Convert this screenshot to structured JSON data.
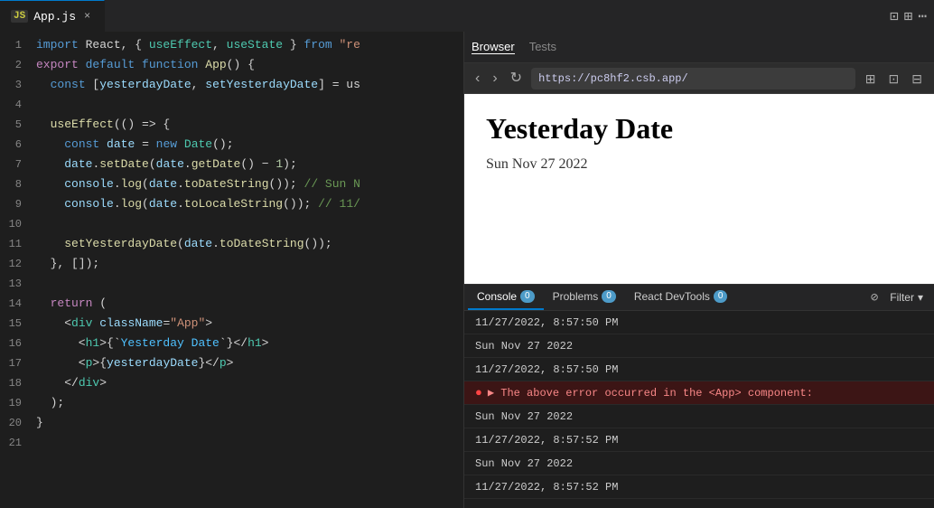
{
  "tabs": [
    {
      "id": "app-js",
      "label": "App.js",
      "icon": "JS",
      "active": true,
      "close": "×"
    }
  ],
  "tab_actions": [
    "⊡",
    "⊞",
    "⋯"
  ],
  "browser": {
    "tabs": [
      {
        "label": "Browser",
        "active": true
      },
      {
        "label": "Tests",
        "active": false
      }
    ],
    "nav": {
      "back": "‹",
      "forward": "›",
      "refresh": "↻",
      "url": "https://pc8hf2.csb.app/"
    },
    "toolbar_icons": [
      "⊞",
      "⊡",
      "⊟"
    ],
    "page": {
      "title": "Yesterday Date",
      "date": "Sun Nov 27 2022"
    }
  },
  "console": {
    "tabs": [
      {
        "label": "Console",
        "badge": "0",
        "active": true
      },
      {
        "label": "Problems",
        "badge": "0",
        "active": false
      },
      {
        "label": "React DevTools",
        "badge": "0",
        "active": false
      }
    ],
    "filter_label": "Filter",
    "messages": [
      {
        "type": "log",
        "text": "11/27/2022, 8:57:50 PM"
      },
      {
        "type": "log",
        "text": "Sun Nov 27 2022"
      },
      {
        "type": "log",
        "text": "11/27/2022, 8:57:50 PM"
      },
      {
        "type": "error",
        "text": "▶ The above error occurred in the <App> component:"
      },
      {
        "type": "log",
        "text": "Sun Nov 27 2022"
      },
      {
        "type": "log",
        "text": "11/27/2022, 8:57:52 PM"
      },
      {
        "type": "log",
        "text": "Sun Nov 27 2022"
      },
      {
        "type": "log",
        "text": "11/27/2022, 8:57:52 PM"
      }
    ]
  },
  "code": {
    "lines": [
      {
        "num": 1,
        "tokens": [
          {
            "t": "kw",
            "v": "import"
          },
          {
            "t": "punct",
            "v": " React, { "
          },
          {
            "t": "cls",
            "v": "useEffect"
          },
          {
            "t": "punct",
            "v": ", "
          },
          {
            "t": "cls",
            "v": "useState"
          },
          {
            "t": "punct",
            "v": " } "
          },
          {
            "t": "kw",
            "v": "from"
          },
          {
            "t": "str",
            "v": " \"re"
          }
        ]
      },
      {
        "num": 2,
        "tokens": [
          {
            "t": "kw2",
            "v": "export"
          },
          {
            "t": "kw",
            "v": " default"
          },
          {
            "t": "kw",
            "v": " function"
          },
          {
            "t": "punct",
            "v": " "
          },
          {
            "t": "fn",
            "v": "App"
          },
          {
            "t": "punct",
            "v": "() {"
          }
        ]
      },
      {
        "num": 3,
        "tokens": [
          {
            "t": "punct",
            "v": "  "
          },
          {
            "t": "kw",
            "v": "const"
          },
          {
            "t": "punct",
            "v": " ["
          },
          {
            "t": "var",
            "v": "yesterdayDate"
          },
          {
            "t": "punct",
            "v": ", "
          },
          {
            "t": "var",
            "v": "setYesterdayDate"
          },
          {
            "t": "punct",
            "v": "] = us"
          }
        ]
      },
      {
        "num": 4,
        "tokens": []
      },
      {
        "num": 5,
        "tokens": [
          {
            "t": "punct",
            "v": "  "
          },
          {
            "t": "fn",
            "v": "useEffect"
          },
          {
            "t": "punct",
            "v": "(() => {"
          }
        ]
      },
      {
        "num": 6,
        "tokens": [
          {
            "t": "punct",
            "v": "    "
          },
          {
            "t": "kw",
            "v": "const"
          },
          {
            "t": "punct",
            "v": " "
          },
          {
            "t": "var",
            "v": "date"
          },
          {
            "t": "punct",
            "v": " = "
          },
          {
            "t": "kw",
            "v": "new"
          },
          {
            "t": "punct",
            "v": " "
          },
          {
            "t": "cls",
            "v": "Date"
          },
          {
            "t": "punct",
            "v": "();"
          }
        ]
      },
      {
        "num": 7,
        "tokens": [
          {
            "t": "punct",
            "v": "    "
          },
          {
            "t": "var",
            "v": "date"
          },
          {
            "t": "punct",
            "v": "."
          },
          {
            "t": "fn",
            "v": "setDate"
          },
          {
            "t": "punct",
            "v": "("
          },
          {
            "t": "var",
            "v": "date"
          },
          {
            "t": "punct",
            "v": "."
          },
          {
            "t": "fn",
            "v": "getDate"
          },
          {
            "t": "punct",
            "v": "() − "
          },
          {
            "t": "num",
            "v": "1"
          },
          {
            "t": "punct",
            "v": ");"
          }
        ]
      },
      {
        "num": 8,
        "tokens": [
          {
            "t": "punct",
            "v": "    "
          },
          {
            "t": "var",
            "v": "console"
          },
          {
            "t": "punct",
            "v": "."
          },
          {
            "t": "fn",
            "v": "log"
          },
          {
            "t": "punct",
            "v": "("
          },
          {
            "t": "var",
            "v": "date"
          },
          {
            "t": "punct",
            "v": "."
          },
          {
            "t": "fn",
            "v": "toDateString"
          },
          {
            "t": "punct",
            "v": "()); "
          },
          {
            "t": "cmt",
            "v": "// Sun N"
          }
        ]
      },
      {
        "num": 9,
        "tokens": [
          {
            "t": "punct",
            "v": "    "
          },
          {
            "t": "var",
            "v": "console"
          },
          {
            "t": "punct",
            "v": "."
          },
          {
            "t": "fn",
            "v": "log"
          },
          {
            "t": "punct",
            "v": "("
          },
          {
            "t": "var",
            "v": "date"
          },
          {
            "t": "punct",
            "v": "."
          },
          {
            "t": "fn",
            "v": "toLocaleString"
          },
          {
            "t": "punct",
            "v": "()); "
          },
          {
            "t": "cmt",
            "v": "// 11/"
          }
        ]
      },
      {
        "num": 10,
        "tokens": []
      },
      {
        "num": 11,
        "tokens": [
          {
            "t": "punct",
            "v": "    "
          },
          {
            "t": "fn",
            "v": "setYesterdayDate"
          },
          {
            "t": "punct",
            "v": "("
          },
          {
            "t": "var",
            "v": "date"
          },
          {
            "t": "punct",
            "v": "."
          },
          {
            "t": "fn",
            "v": "toDateString"
          },
          {
            "t": "punct",
            "v": "());"
          }
        ]
      },
      {
        "num": 12,
        "tokens": [
          {
            "t": "punct",
            "v": "  }, []);"
          }
        ]
      },
      {
        "num": 13,
        "tokens": []
      },
      {
        "num": 14,
        "tokens": [
          {
            "t": "punct",
            "v": "  "
          },
          {
            "t": "kw2",
            "v": "return"
          },
          {
            "t": "punct",
            "v": " ("
          }
        ]
      },
      {
        "num": 15,
        "tokens": [
          {
            "t": "punct",
            "v": "    <"
          },
          {
            "t": "jsx-tag",
            "v": "div"
          },
          {
            "t": "punct",
            "v": " "
          },
          {
            "t": "jsx-attr",
            "v": "className"
          },
          {
            "t": "punct",
            "v": "="
          },
          {
            "t": "jsx-str",
            "v": "\"App\""
          },
          {
            "t": "punct",
            "v": ">"
          }
        ]
      },
      {
        "num": 16,
        "tokens": [
          {
            "t": "punct",
            "v": "      <"
          },
          {
            "t": "jsx-tag",
            "v": "h1"
          },
          {
            "t": "punct",
            "v": ">{`"
          },
          {
            "t": "tpl",
            "v": "Yesterday Date"
          },
          {
            "t": "punct",
            "v": "`}</"
          },
          {
            "t": "jsx-tag",
            "v": "h1"
          },
          {
            "t": "punct",
            "v": ">"
          }
        ]
      },
      {
        "num": 17,
        "tokens": [
          {
            "t": "punct",
            "v": "      <"
          },
          {
            "t": "jsx-tag",
            "v": "p"
          },
          {
            "t": "punct",
            "v": ">{"
          },
          {
            "t": "var",
            "v": "yesterdayDate"
          },
          {
            "t": "punct",
            "v": "}</"
          },
          {
            "t": "jsx-tag",
            "v": "p"
          },
          {
            "t": "punct",
            "v": ">"
          }
        ]
      },
      {
        "num": 18,
        "tokens": [
          {
            "t": "punct",
            "v": "    </"
          },
          {
            "t": "jsx-tag",
            "v": "div"
          },
          {
            "t": "punct",
            "v": ">"
          }
        ]
      },
      {
        "num": 19,
        "tokens": [
          {
            "t": "punct",
            "v": "  );"
          }
        ]
      },
      {
        "num": 20,
        "tokens": [
          {
            "t": "punct",
            "v": "}"
          }
        ]
      },
      {
        "num": 21,
        "tokens": []
      }
    ]
  }
}
